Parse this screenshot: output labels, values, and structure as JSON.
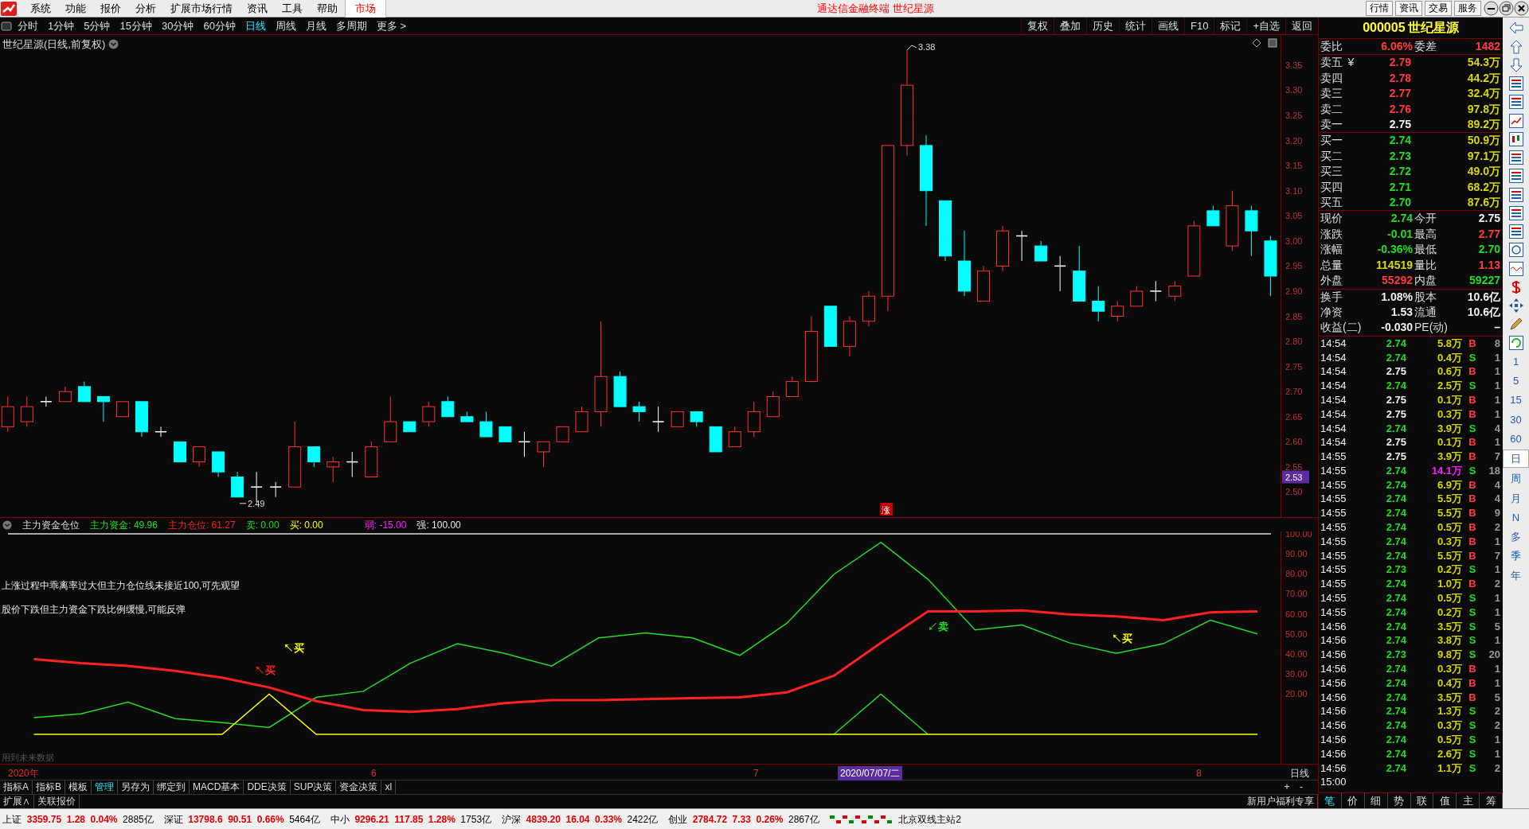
{
  "menu_bar": {
    "items": [
      {
        "label": "系统",
        "selected": false
      },
      {
        "label": "功能",
        "selected": false
      },
      {
        "label": "报价",
        "selected": false
      },
      {
        "label": "分析",
        "selected": false
      },
      {
        "label": "扩展市场行情",
        "selected": false
      },
      {
        "label": "资讯",
        "selected": false
      },
      {
        "label": "工具",
        "selected": false
      },
      {
        "label": "帮助",
        "selected": false
      },
      {
        "label": "市场",
        "selected": true
      }
    ],
    "title": "通达信金融终端 世纪星源",
    "buttons": [
      "行情",
      "资讯",
      "交易",
      "服务"
    ]
  },
  "period_tabs": [
    {
      "label": "分时",
      "selected": false
    },
    {
      "label": "1分钟",
      "selected": false
    },
    {
      "label": "5分钟",
      "selected": false
    },
    {
      "label": "15分钟",
      "selected": false
    },
    {
      "label": "30分钟",
      "selected": false
    },
    {
      "label": "60分钟",
      "selected": false
    },
    {
      "label": "日线",
      "selected": true
    },
    {
      "label": "周线",
      "selected": false
    },
    {
      "label": "月线",
      "selected": false
    },
    {
      "label": "多周期",
      "selected": false
    },
    {
      "label": "更多 >",
      "selected": false
    }
  ],
  "chart_tools": [
    "复权",
    "叠加",
    "历史",
    "统计",
    "画线",
    "F10",
    "标记",
    "+自选",
    "返回"
  ],
  "main_chart": {
    "title": "世纪星源(日线,前复权)",
    "current_price": "2.53",
    "high_label": "3.38",
    "low_label": "2.49",
    "badge": "涨",
    "chart_data": {
      "type": "candlestick",
      "grid": true,
      "ylim": [
        2.45,
        3.41
      ],
      "ohlc": [
        [
          2.63,
          2.69,
          2.62,
          2.67
        ],
        [
          2.64,
          2.69,
          2.63,
          2.67
        ],
        [
          2.68,
          2.69,
          2.67,
          2.68
        ],
        [
          2.68,
          2.71,
          2.68,
          2.7
        ],
        [
          2.71,
          2.72,
          2.68,
          2.68
        ],
        [
          2.69,
          2.69,
          2.64,
          2.68
        ],
        [
          2.65,
          2.68,
          2.65,
          2.68
        ],
        [
          2.68,
          2.68,
          2.61,
          2.62
        ],
        [
          2.62,
          2.63,
          2.61,
          2.62
        ],
        [
          2.6,
          2.6,
          2.56,
          2.56
        ],
        [
          2.56,
          2.59,
          2.55,
          2.59
        ],
        [
          2.58,
          2.58,
          2.53,
          2.54
        ],
        [
          2.53,
          2.54,
          2.49,
          2.49
        ],
        [
          2.51,
          2.54,
          2.48,
          2.51
        ],
        [
          2.51,
          2.52,
          2.49,
          2.51
        ],
        [
          2.51,
          2.64,
          2.51,
          2.59
        ],
        [
          2.59,
          2.59,
          2.55,
          2.56
        ],
        [
          2.55,
          2.57,
          2.52,
          2.56
        ],
        [
          2.56,
          2.58,
          2.53,
          2.56
        ],
        [
          2.53,
          2.6,
          2.53,
          2.59
        ],
        [
          2.6,
          2.69,
          2.6,
          2.64
        ],
        [
          2.64,
          2.64,
          2.62,
          2.62
        ],
        [
          2.64,
          2.68,
          2.63,
          2.67
        ],
        [
          2.68,
          2.69,
          2.65,
          2.65
        ],
        [
          2.65,
          2.66,
          2.64,
          2.64
        ],
        [
          2.64,
          2.66,
          2.61,
          2.61
        ],
        [
          2.63,
          2.63,
          2.6,
          2.6
        ],
        [
          2.6,
          2.62,
          2.57,
          2.6
        ],
        [
          2.58,
          2.6,
          2.55,
          2.6
        ],
        [
          2.6,
          2.63,
          2.6,
          2.63
        ],
        [
          2.62,
          2.67,
          2.62,
          2.66
        ],
        [
          2.66,
          2.84,
          2.63,
          2.73
        ],
        [
          2.73,
          2.74,
          2.67,
          2.67
        ],
        [
          2.67,
          2.68,
          2.64,
          2.66
        ],
        [
          2.64,
          2.67,
          2.62,
          2.64
        ],
        [
          2.63,
          2.66,
          2.63,
          2.66
        ],
        [
          2.66,
          2.66,
          2.63,
          2.64
        ],
        [
          2.63,
          2.63,
          2.58,
          2.58
        ],
        [
          2.59,
          2.63,
          2.59,
          2.62
        ],
        [
          2.62,
          2.68,
          2.61,
          2.66
        ],
        [
          2.65,
          2.7,
          2.65,
          2.69
        ],
        [
          2.69,
          2.73,
          2.69,
          2.72
        ],
        [
          2.72,
          2.85,
          2.72,
          2.82
        ],
        [
          2.87,
          2.87,
          2.79,
          2.79
        ],
        [
          2.79,
          2.85,
          2.77,
          2.84
        ],
        [
          2.84,
          2.9,
          2.83,
          2.89
        ],
        [
          2.89,
          3.19,
          2.86,
          3.19
        ],
        [
          3.19,
          3.38,
          3.17,
          3.31
        ],
        [
          3.19,
          3.21,
          3.03,
          3.1
        ],
        [
          3.08,
          3.08,
          2.96,
          2.97
        ],
        [
          2.96,
          3.02,
          2.89,
          2.9
        ],
        [
          2.88,
          2.95,
          2.88,
          2.94
        ],
        [
          2.95,
          3.03,
          2.94,
          3.02
        ],
        [
          3.01,
          3.02,
          2.96,
          3.01
        ],
        [
          2.99,
          3.0,
          2.96,
          2.96
        ],
        [
          2.95,
          2.97,
          2.9,
          2.95
        ],
        [
          2.94,
          2.99,
          2.88,
          2.88
        ],
        [
          2.88,
          2.91,
          2.84,
          2.86
        ],
        [
          2.85,
          2.88,
          2.84,
          2.87
        ],
        [
          2.87,
          2.91,
          2.87,
          2.9
        ],
        [
          2.9,
          2.92,
          2.88,
          2.9
        ],
        [
          2.89,
          2.92,
          2.88,
          2.91
        ],
        [
          2.93,
          3.04,
          2.93,
          3.03
        ],
        [
          3.06,
          3.07,
          3.03,
          3.03
        ],
        [
          2.99,
          3.1,
          2.98,
          3.07
        ],
        [
          3.06,
          3.07,
          2.97,
          3.02
        ],
        [
          3.0,
          3.01,
          2.89,
          2.93
        ]
      ],
      "yticks": [
        {
          "value": 3.35,
          "label": "3.35"
        },
        {
          "value": 3.3,
          "label": "3.30"
        },
        {
          "value": 3.25,
          "label": "3.25"
        },
        {
          "value": 3.2,
          "label": "3.20"
        },
        {
          "value": 3.15,
          "label": "3.15"
        },
        {
          "value": 3.1,
          "label": "3.10"
        },
        {
          "value": 3.05,
          "label": "3.05"
        },
        {
          "value": 3,
          "label": "3.00"
        },
        {
          "value": 2.95,
          "label": "2.95"
        },
        {
          "value": 2.9,
          "label": "2.90"
        },
        {
          "value": 2.85,
          "label": "2.85"
        },
        {
          "value": 2.8,
          "label": "2.80"
        },
        {
          "value": 2.75,
          "label": "2.75"
        },
        {
          "value": 2.7,
          "label": "2.70"
        },
        {
          "value": 2.65,
          "label": "2.65"
        },
        {
          "value": 2.6,
          "label": "2.60"
        },
        {
          "value": 2.55,
          "label": "2.55"
        },
        {
          "value": 2.5,
          "label": "2.50"
        }
      ]
    }
  },
  "indicator": {
    "name": "主力资金仓位",
    "legend": [
      {
        "value": ": 49.96"
      },
      {
        "value": ": 61.27"
      },
      {
        "value": ": 0.00"
      },
      {
        "value": ": 0.00"
      },
      {
        "label": "弱",
        "value": ": -15.00",
        "color": "#ff20ff"
      },
      {
        "label": "强",
        "value": ": 100.00",
        "color": "#e8e8e8"
      }
    ],
    "notes": [
      "上涨过程中乖离率过大但主力仓位线未接近100,可先观望",
      "股价下跌但主力资金下跌比例缓慢,可能反弹"
    ],
    "warning": "用到未来数据",
    "signal_labels": [
      {
        "text": "↖买",
        "color": "#ffff00"
      },
      {
        "text": "↖买",
        "color": "#ff2020"
      },
      {
        "text": "↙卖",
        "color": "#22dd22"
      },
      {
        "text": "↖买",
        "color": "#ffff00"
      }
    ],
    "chart_data": {
      "type": "line",
      "ylim": [
        -14.67,
        101
      ],
      "yticks": [
        {
          "value": 100,
          "label": "100.00"
        },
        {
          "value": 90,
          "label": "90.00"
        },
        {
          "value": 80,
          "label": "80.00"
        },
        {
          "value": 70,
          "label": "70.00"
        },
        {
          "value": 60,
          "label": "60.00"
        },
        {
          "value": 50,
          "label": "50.00"
        },
        {
          "value": 40,
          "label": "40.00"
        },
        {
          "value": 30,
          "label": "30.00"
        },
        {
          "value": 20,
          "label": "20.00"
        }
      ],
      "series": [
        {
          "name": "主力资金",
          "color": "#22dd22",
          "values": [
            8.3,
            10.2,
            16,
            7.8,
            5.8,
            3.4,
            18.4,
            21.4,
            35.4,
            45.1,
            40.3,
            34,
            48,
            50.5,
            48,
            39.3,
            55.3,
            79.6,
            95.6,
            77.2,
            52,
            54.4,
            45.6,
            40.3,
            45.1,
            56.8,
            50
          ]
        },
        {
          "name": "主力仓位",
          "color": "#ff2020",
          "values": [
            37.4,
            35.4,
            34,
            31.6,
            28.2,
            23.3,
            16.5,
            12.1,
            11.2,
            12.6,
            15.5,
            17,
            17,
            17.5,
            18,
            18.4,
            20.9,
            29.1,
            45.6,
            61.2,
            61.2,
            61.7,
            59.7,
            58.7,
            56.8,
            60.7,
            61.2
          ]
        },
        {
          "name": "卖",
          "color": "#22dd22",
          "values": [
            null,
            null,
            null,
            null,
            null,
            null,
            null,
            null,
            null,
            null,
            null,
            null,
            null,
            null,
            null,
            null,
            null,
            0,
            20,
            0,
            null,
            null,
            null,
            null,
            null,
            null,
            null
          ]
        },
        {
          "name": "买",
          "color": "#ffff00",
          "values": [
            0,
            0,
            0,
            0,
            0,
            20,
            0,
            0,
            0,
            0,
            0,
            0,
            0,
            0,
            0,
            0,
            0,
            0,
            0,
            0,
            0,
            0,
            0,
            0,
            0,
            0,
            0
          ]
        }
      ]
    }
  },
  "date_axis": {
    "labels": [
      {
        "label": "2020年",
        "kind": "year",
        "selected": false
      },
      {
        "label": "6",
        "kind": "month",
        "selected": false
      },
      {
        "label": "7",
        "kind": "month",
        "selected": false
      },
      {
        "label": "2020/07/07/二",
        "kind": "cursor",
        "selected": true
      },
      {
        "label": "8",
        "kind": "month",
        "selected": false
      }
    ],
    "period": "日线",
    "zoom_buttons": [
      "+",
      "-"
    ]
  },
  "indicator_tabs": [
    {
      "label": "指标A",
      "selected": false
    },
    {
      "label": "指标B",
      "selected": false
    },
    {
      "label": "模板",
      "selected": false
    },
    {
      "label": "管理",
      "selected": true
    },
    {
      "label": "另存为",
      "selected": false
    },
    {
      "label": "绑定到",
      "selected": false
    },
    {
      "label": "MACD基本",
      "selected": false
    },
    {
      "label": "DDE决策",
      "selected": false
    },
    {
      "label": "SUP决策",
      "selected": false
    },
    {
      "label": "资金决策",
      "selected": false
    },
    {
      "label": "xl",
      "selected": false
    }
  ],
  "link_bar": [
    "扩展∧",
    "关联报价"
  ],
  "promo": "新用户福利专享",
  "quote": {
    "code": "000005",
    "name": "世纪星源",
    "ratio": [
      {
        "label": "委比",
        "value": "6.06%",
        "color": "#ff3b3b"
      },
      {
        "label": "委差",
        "value": "1482",
        "color": "#ff3b3b"
      }
    ],
    "asks": [
      {
        "label": "卖五",
        "mark": "¥",
        "price": "2.79",
        "color": "#ff3b3b",
        "volume": "54.3万"
      },
      {
        "label": "卖四",
        "price": "2.78",
        "color": "#ff3b3b",
        "volume": "44.2万"
      },
      {
        "label": "卖三",
        "price": "2.77",
        "color": "#ff3b3b",
        "volume": "32.4万"
      },
      {
        "label": "卖二",
        "price": "2.76",
        "color": "#ff3b3b",
        "volume": "97.8万"
      },
      {
        "label": "卖一",
        "price": "2.75",
        "color": "#f0f0f0",
        "volume": "89.2万"
      }
    ],
    "bids": [
      {
        "label": "买一",
        "price": "2.74",
        "color": "#22dd22",
        "volume": "50.9万"
      },
      {
        "label": "买二",
        "price": "2.73",
        "color": "#22dd22",
        "volume": "97.1万"
      },
      {
        "label": "买三",
        "price": "2.72",
        "color": "#22dd22",
        "volume": "49.0万"
      },
      {
        "label": "买四",
        "price": "2.71",
        "color": "#22dd22",
        "volume": "68.2万"
      },
      {
        "label": "买五",
        "price": "2.70",
        "color": "#22dd22",
        "volume": "87.6万"
      }
    ],
    "stats": [
      {
        "label": "现价",
        "value": "2.74",
        "color": "#22dd22"
      },
      {
        "label": "今开",
        "value": "2.75",
        "color": "#f0f0f0"
      },
      {
        "label": "涨跌",
        "value": "-0.01",
        "color": "#22dd22"
      },
      {
        "label": "最高",
        "value": "2.77",
        "color": "#ff3b3b"
      },
      {
        "label": "涨幅",
        "value": "-0.36%",
        "color": "#22dd22"
      },
      {
        "label": "最低",
        "value": "2.70",
        "color": "#22dd22"
      },
      {
        "label": "总量",
        "value": "114519",
        "color": "#d8d800"
      },
      {
        "label": "量比",
        "value": "1.13",
        "color": "#ff3b3b"
      },
      {
        "label": "外盘",
        "value": "55292",
        "color": "#ff3b3b"
      },
      {
        "label": "内盘",
        "value": "59227",
        "color": "#22dd22"
      }
    ],
    "info": [
      {
        "label": "换手",
        "value": "1.08%"
      },
      {
        "label": "股本",
        "value": "10.6亿"
      },
      {
        "label": "净资",
        "value": "1.53"
      },
      {
        "label": "流通",
        "value": "10.6亿"
      },
      {
        "label": "收益(二)",
        "value": "-0.030"
      },
      {
        "label": "PE(动)",
        "value": "–"
      }
    ]
  },
  "trades": [
    {
      "time": "14:54",
      "price": "2.74",
      "color": "#22dd22",
      "volume": "5.8万",
      "big": false,
      "side": "B",
      "kind": "buy",
      "count": "8"
    },
    {
      "time": "14:54",
      "price": "2.74",
      "color": "#22dd22",
      "volume": "0.4万",
      "big": false,
      "side": "S",
      "kind": "sell",
      "count": "1"
    },
    {
      "time": "14:54",
      "price": "2.75",
      "color": "#f0f0f0",
      "volume": "0.6万",
      "big": false,
      "side": "B",
      "kind": "buy",
      "count": "1"
    },
    {
      "time": "14:54",
      "price": "2.74",
      "color": "#22dd22",
      "volume": "2.5万",
      "big": false,
      "side": "S",
      "kind": "sell",
      "count": "1"
    },
    {
      "time": "14:54",
      "price": "2.75",
      "color": "#f0f0f0",
      "volume": "0.1万",
      "big": false,
      "side": "B",
      "kind": "buy",
      "count": "1"
    },
    {
      "time": "14:54",
      "price": "2.75",
      "color": "#f0f0f0",
      "volume": "0.3万",
      "big": false,
      "side": "B",
      "kind": "buy",
      "count": "1"
    },
    {
      "time": "14:54",
      "price": "2.74",
      "color": "#22dd22",
      "volume": "3.9万",
      "big": false,
      "side": "S",
      "kind": "sell",
      "count": "4"
    },
    {
      "time": "14:54",
      "price": "2.75",
      "color": "#f0f0f0",
      "volume": "0.1万",
      "big": false,
      "side": "B",
      "kind": "buy",
      "count": "1"
    },
    {
      "time": "14:55",
      "price": "2.75",
      "color": "#f0f0f0",
      "volume": "3.9万",
      "big": false,
      "side": "B",
      "kind": "buy",
      "count": "7"
    },
    {
      "time": "14:55",
      "price": "2.74",
      "color": "#22dd22",
      "volume": "14.1万",
      "big": true,
      "side": "S",
      "kind": "sell",
      "count": "18"
    },
    {
      "time": "14:55",
      "price": "2.74",
      "color": "#22dd22",
      "volume": "6.9万",
      "big": false,
      "side": "B",
      "kind": "buy",
      "count": "4"
    },
    {
      "time": "14:55",
      "price": "2.74",
      "color": "#22dd22",
      "volume": "5.5万",
      "big": false,
      "side": "B",
      "kind": "buy",
      "count": "4"
    },
    {
      "time": "14:55",
      "price": "2.74",
      "color": "#22dd22",
      "volume": "5.5万",
      "big": false,
      "side": "B",
      "kind": "buy",
      "count": "9"
    },
    {
      "time": "14:55",
      "price": "2.74",
      "color": "#22dd22",
      "volume": "0.5万",
      "big": false,
      "side": "B",
      "kind": "buy",
      "count": "2"
    },
    {
      "time": "14:55",
      "price": "2.74",
      "color": "#22dd22",
      "volume": "0.3万",
      "big": false,
      "side": "B",
      "kind": "buy",
      "count": "1"
    },
    {
      "time": "14:55",
      "price": "2.74",
      "color": "#22dd22",
      "volume": "5.5万",
      "big": false,
      "side": "B",
      "kind": "buy",
      "count": "7"
    },
    {
      "time": "14:55",
      "price": "2.73",
      "color": "#22dd22",
      "volume": "0.2万",
      "big": false,
      "side": "S",
      "kind": "sell",
      "count": "1"
    },
    {
      "time": "14:55",
      "price": "2.74",
      "color": "#22dd22",
      "volume": "1.0万",
      "big": false,
      "side": "B",
      "kind": "buy",
      "count": "2"
    },
    {
      "time": "14:55",
      "price": "2.74",
      "color": "#22dd22",
      "volume": "0.5万",
      "big": false,
      "side": "S",
      "kind": "sell",
      "count": "1"
    },
    {
      "time": "14:55",
      "price": "2.74",
      "color": "#22dd22",
      "volume": "0.2万",
      "big": false,
      "side": "S",
      "kind": "sell",
      "count": "1"
    },
    {
      "time": "14:56",
      "price": "2.74",
      "color": "#22dd22",
      "volume": "3.5万",
      "big": false,
      "side": "S",
      "kind": "sell",
      "count": "5"
    },
    {
      "time": "14:56",
      "price": "2.74",
      "color": "#22dd22",
      "volume": "3.8万",
      "big": false,
      "side": "S",
      "kind": "sell",
      "count": "1"
    },
    {
      "time": "14:56",
      "price": "2.73",
      "color": "#22dd22",
      "volume": "9.8万",
      "big": false,
      "side": "S",
      "kind": "sell",
      "count": "20"
    },
    {
      "time": "14:56",
      "price": "2.74",
      "color": "#22dd22",
      "volume": "0.3万",
      "big": false,
      "side": "B",
      "kind": "buy",
      "count": "1"
    },
    {
      "time": "14:56",
      "price": "2.74",
      "color": "#22dd22",
      "volume": "0.4万",
      "big": false,
      "side": "B",
      "kind": "buy",
      "count": "1"
    },
    {
      "time": "14:56",
      "price": "2.74",
      "color": "#22dd22",
      "volume": "3.5万",
      "big": false,
      "side": "B",
      "kind": "buy",
      "count": "5"
    },
    {
      "time": "14:56",
      "price": "2.74",
      "color": "#22dd22",
      "volume": "1.3万",
      "big": false,
      "side": "S",
      "kind": "sell",
      "count": "2"
    },
    {
      "time": "14:56",
      "price": "2.74",
      "color": "#22dd22",
      "volume": "0.3万",
      "big": false,
      "side": "S",
      "kind": "sell",
      "count": "2"
    },
    {
      "time": "14:56",
      "price": "2.74",
      "color": "#22dd22",
      "volume": "0.5万",
      "big": false,
      "side": "S",
      "kind": "sell",
      "count": "1"
    },
    {
      "time": "14:56",
      "price": "2.74",
      "color": "#22dd22",
      "volume": "2.6万",
      "big": false,
      "side": "S",
      "kind": "sell",
      "count": "1"
    },
    {
      "time": "14:56",
      "price": "2.74",
      "color": "#22dd22",
      "volume": "1.1万",
      "big": false,
      "side": "S",
      "kind": "sell",
      "count": "2"
    },
    {
      "time": "15:00"
    }
  ],
  "trade_tabs": [
    {
      "label": "笔",
      "selected": true
    },
    {
      "label": "价",
      "selected": false
    },
    {
      "label": "细",
      "selected": false
    },
    {
      "label": "势",
      "selected": false
    },
    {
      "label": "联",
      "selected": false
    },
    {
      "label": "值",
      "selected": false
    },
    {
      "label": "主",
      "selected": false
    },
    {
      "label": "筹",
      "selected": false
    }
  ],
  "side_periods": [
    {
      "label": "1",
      "selected": false
    },
    {
      "label": "5",
      "selected": false
    },
    {
      "label": "15",
      "selected": false
    },
    {
      "label": "30",
      "selected": false
    },
    {
      "label": "60",
      "selected": false
    },
    {
      "label": "日",
      "selected": true
    },
    {
      "label": "周",
      "selected": false
    },
    {
      "label": "月",
      "selected": false
    },
    {
      "label": "N",
      "selected": false
    },
    {
      "label": "多",
      "selected": false
    },
    {
      "label": "季",
      "selected": false
    },
    {
      "label": "年",
      "selected": false
    }
  ],
  "status_bar": {
    "indices": [
      {
        "name": "上证",
        "value": "3359.75",
        "change": "1.28",
        "percent": "0.04%",
        "amount": "2885亿"
      },
      {
        "name": "深证",
        "value": "13798.6",
        "change": "90.51",
        "percent": "0.66%",
        "amount": "5464亿"
      },
      {
        "name": "中小",
        "value": "9296.21",
        "change": "117.85",
        "percent": "1.28%",
        "amount": "1753亿"
      },
      {
        "name": "沪深",
        "value": "4839.20",
        "change": "16.04",
        "percent": "0.33%",
        "amount": "2422亿"
      },
      {
        "name": "创业",
        "value": "2784.72",
        "change": "7.33",
        "percent": "0.26%",
        "amount": "2867亿"
      }
    ],
    "server": "北京双线主站2"
  }
}
